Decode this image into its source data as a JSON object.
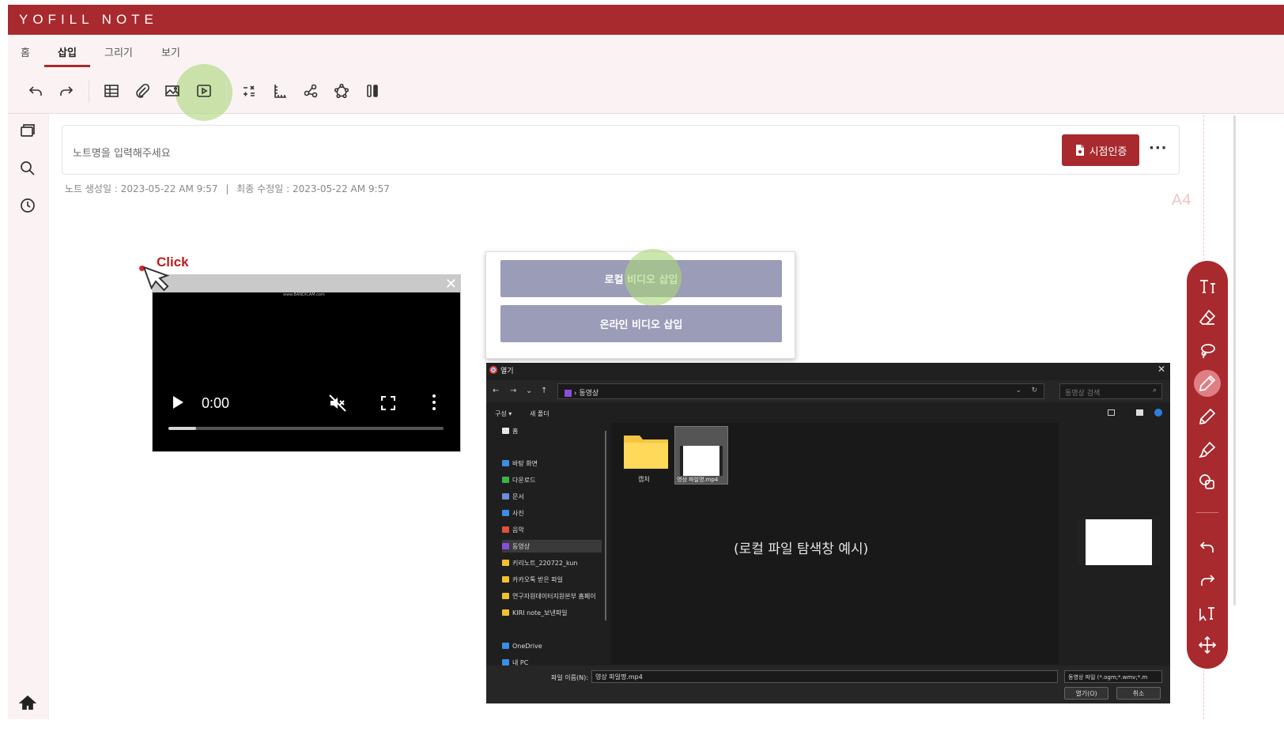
{
  "app": {
    "title": "YOFILL NOTE"
  },
  "ribbon": {
    "tabs": [
      {
        "label": "홈"
      },
      {
        "label": "삽입"
      },
      {
        "label": "그리기"
      },
      {
        "label": "보기"
      }
    ],
    "active_tab": "삽입",
    "tools": [
      "undo-icon",
      "redo-icon",
      "table-icon",
      "attachment-icon",
      "image-icon",
      "video-icon",
      "formula-icon",
      "ruler-icon",
      "share-icon",
      "shape-icon",
      "test-tube-icon"
    ],
    "highlighted_tool": "video-icon"
  },
  "left_rail": {
    "items": [
      "pages-icon",
      "search-icon",
      "history-icon",
      "home-icon"
    ]
  },
  "note": {
    "title_placeholder": "노트명을 입력해주세요",
    "cert_button": "시점인증",
    "more_button": "···",
    "created_label": "노트 생성일 : 2023-05-22 AM 9:57",
    "separator": "|",
    "modified_label": "최종 수정일 : 2023-05-22 AM 9:57",
    "page_size": "A4"
  },
  "annotation": {
    "click_label": "Click"
  },
  "video_player": {
    "watermark": "www.BANDICAM.com",
    "time": "0:00",
    "progress": 0.1,
    "muted": true
  },
  "insert_popup": {
    "local_button": "로컬 비디오 삽입",
    "online_button": "온라인 비디오 삽입"
  },
  "file_dialog": {
    "title": "열기",
    "address": "동영상",
    "search_placeholder": "동영상 검색",
    "cmd_organize": "구성 ▾",
    "cmd_new_folder": "새 폴더",
    "sidebar": [
      {
        "label": "홈",
        "color": "#e8e8e8"
      },
      {
        "label": "바탕 화면",
        "color": "#3a8ee6"
      },
      {
        "label": "다운로드",
        "color": "#39b54a"
      },
      {
        "label": "문서",
        "color": "#6a8fd8"
      },
      {
        "label": "사진",
        "color": "#3a8ee6"
      },
      {
        "label": "음악",
        "color": "#e0533a"
      },
      {
        "label": "동영상",
        "color": "#8a4fd8"
      },
      {
        "label": "키리노트_220722_kun",
        "color": "#f2c12e"
      },
      {
        "label": "카카오톡 받은 파일",
        "color": "#f2c12e"
      },
      {
        "label": "연구자원데이터지원본부 홈페이",
        "color": "#f2c12e"
      },
      {
        "label": "KIRI note_보낸파일",
        "color": "#f2c12e"
      },
      {
        "label": "OneDrive",
        "color": "#3a8ee6"
      },
      {
        "label": "내 PC",
        "color": "#3a8ee6"
      }
    ],
    "selected_item": "동영상",
    "files": [
      {
        "label": "캡처",
        "type": "folder-icon"
      },
      {
        "label": "영상 파일명.mp4",
        "type": "video-file-icon"
      }
    ],
    "caption": "(로컬 파일 탐색창 예시)",
    "filename_label": "파일 이름(N):",
    "filename_value": "영상 파일명.mp4",
    "filter_value": "동영상 파일 (*.ogm;*.wmv;*.m",
    "open_button": "열기(O)",
    "cancel_button": "취소"
  },
  "right_toolbar": {
    "tools": [
      "text-icon",
      "eraser-icon",
      "lasso-icon",
      "pen-icon",
      "pencil-icon",
      "highlighter-icon",
      "shapes-icon",
      "undo-icon",
      "redo-icon",
      "select-text-icon",
      "move-icon"
    ],
    "active_tool": "pen-icon"
  },
  "colors": {
    "brand": "#a82a2e",
    "popup_button": "#9b9cb8",
    "highlight": "#aad778"
  }
}
